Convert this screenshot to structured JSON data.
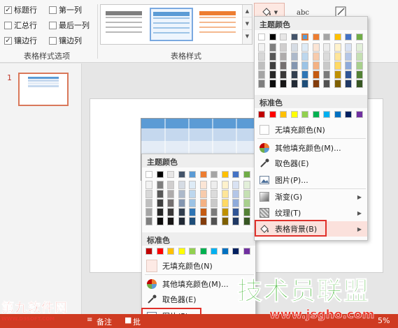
{
  "ribbon": {
    "options": [
      {
        "label": "标题行",
        "checked": true
      },
      {
        "label": "第一列",
        "checked": false
      },
      {
        "label": "汇总行",
        "checked": false
      },
      {
        "label": "最后一列",
        "checked": false
      },
      {
        "label": "镶边行",
        "checked": true
      },
      {
        "label": "镶边列",
        "checked": false
      }
    ],
    "options_group_label": "表格样式选项",
    "styles_group_label": "表格样式",
    "style_colors": [
      "#7f7f7f",
      "#5b9bd5",
      "#ed7d31"
    ],
    "abc_label": "abc"
  },
  "slide_number": "1",
  "palette": {
    "theme_top": [
      "#ffffff",
      "#000000",
      "#e7e6e6",
      "#44546a",
      "#5b9bd5",
      "#ed7d31",
      "#a5a5a5",
      "#ffc000",
      "#4472c4",
      "#70ad47"
    ],
    "theme_shades": [
      [
        "#f2f2f2",
        "#7f7f7f",
        "#d0cece",
        "#d6dce4",
        "#deebf6",
        "#fbe5d5",
        "#ededed",
        "#fff2cc",
        "#d9e2f3",
        "#e2efd9"
      ],
      [
        "#d8d8d8",
        "#595959",
        "#aeabab",
        "#adb9ca",
        "#bdd7ee",
        "#f7cbac",
        "#dbdbdb",
        "#fee599",
        "#b4c6e7",
        "#c5e0b3"
      ],
      [
        "#bfbfbf",
        "#3f3f3f",
        "#757070",
        "#8496b0",
        "#9cc3e5",
        "#f4b183",
        "#c9c9c9",
        "#ffd965",
        "#8eaadb",
        "#a8d08d"
      ],
      [
        "#a5a5a5",
        "#262626",
        "#3a3838",
        "#323f4f",
        "#2e75b5",
        "#c55a11",
        "#7b7b7b",
        "#bf9000",
        "#2f5496",
        "#538135"
      ],
      [
        "#7f7f7f",
        "#0c0c0c",
        "#171616",
        "#222a35",
        "#1f4e79",
        "#833c0b",
        "#525252",
        "#7f6000",
        "#1f3864",
        "#375623"
      ]
    ],
    "standard": [
      "#c00000",
      "#ff0000",
      "#ffc000",
      "#ffff00",
      "#92d050",
      "#00b050",
      "#00b0f0",
      "#0070c0",
      "#002060",
      "#7030a0"
    ]
  },
  "menu_right": {
    "theme_title": "主题颜色",
    "standard_title": "标准色",
    "no_fill": "无填充颜色(N)",
    "more_colors": "其他填充颜色(M)...",
    "eyedropper": "取色器(E)",
    "picture": "图片(P)...",
    "gradient": "渐变(G)",
    "texture": "纹理(T)",
    "table_background": "表格背景(B)"
  },
  "menu_left": {
    "theme_title": "主题颜色",
    "standard_title": "标准色",
    "no_fill": "无填充颜色(N)",
    "more_colors": "其他填充颜色(M)...",
    "eyedropper": "取色器(E)",
    "picture": "图片(P)..."
  },
  "status": {
    "notes": "备注",
    "comments_partial": "批",
    "zoom_partial": "5%"
  },
  "watermarks": {
    "left": "第九软件网",
    "left_url": "WWW.D9SOFT.COM",
    "right": "技术员联盟",
    "right_url": "www.jsgho.com"
  }
}
